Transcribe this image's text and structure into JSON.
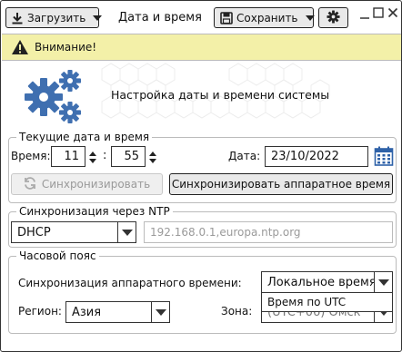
{
  "toolbar": {
    "load_label": "Загрузить",
    "title": "Дата и время",
    "save_label": "Сохранить"
  },
  "banner": {
    "warning_text": "Внимание!"
  },
  "header": {
    "heading": "Настройка даты и времени системы"
  },
  "current": {
    "legend": "Текущие дата и время",
    "time_label": "Время:",
    "hours": "11",
    "minutes": "55",
    "date_label": "Дата:",
    "date_value": "23/10/2022",
    "sync_button": "Синхронизировать",
    "sync_hw_button": "Синхронизировать аппаратное время"
  },
  "ntp": {
    "legend": "Синхронизация через NTP",
    "mode": "DHCP",
    "servers": "192.168.0.1,europa.ntp.org"
  },
  "tz": {
    "legend": "Часовой пояс",
    "hw_sync_label": "Синхронизация аппаратного времени:",
    "hw_sync_value": "Локальное время",
    "hw_sync_option_utc": "Время по UTC",
    "region_label": "Регион:",
    "region_value": "Азия",
    "zone_label": "Зона:",
    "zone_partial": "(UTC+06) Омск"
  },
  "colors": {
    "banner_bg": "#f3f0a8",
    "gear_blue": "#3f6fb0",
    "calendar_blue": "#2f62a8"
  }
}
